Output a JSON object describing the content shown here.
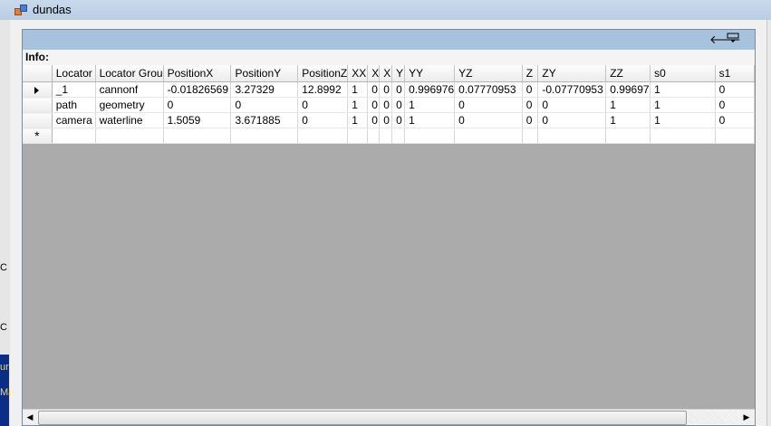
{
  "window": {
    "title": "dundas"
  },
  "pane": {
    "back_icon": "back-arrow-icon",
    "menu_icon": "dropdown-menu-icon"
  },
  "info_label": "Info:",
  "grid": {
    "columns": [
      "Locator",
      "Locator Grou",
      "PositionX",
      "PositionY",
      "PositionZ",
      "XX",
      "X",
      "X",
      "Y",
      "YY",
      "YZ",
      "Z",
      "ZY",
      "ZZ",
      "s0",
      "s1"
    ],
    "rows": [
      {
        "current": true,
        "cells": [
          "_1",
          "cannonf",
          "-0.01826569",
          "3.27329",
          "12.8992",
          "1",
          "0",
          "0",
          "0",
          "0.996976",
          "0.07770953",
          "0",
          "-0.07770953",
          "0.99697",
          "1",
          "0"
        ]
      },
      {
        "current": false,
        "cells": [
          "path",
          "geometry",
          "0",
          "0",
          "0",
          "1",
          "0",
          "0",
          "0",
          "1",
          "0",
          "0",
          "0",
          "1",
          "1",
          "0"
        ]
      },
      {
        "current": false,
        "cells": [
          "camera",
          "waterline",
          "1.5059",
          "3.671885",
          "0",
          "1",
          "0",
          "0",
          "0",
          "1",
          "0",
          "0",
          "0",
          "1",
          "1",
          "0"
        ]
      }
    ],
    "new_row_marker": "*"
  },
  "background_window_fragments": [
    "C",
    "C",
    "ur",
    "Ma"
  ]
}
